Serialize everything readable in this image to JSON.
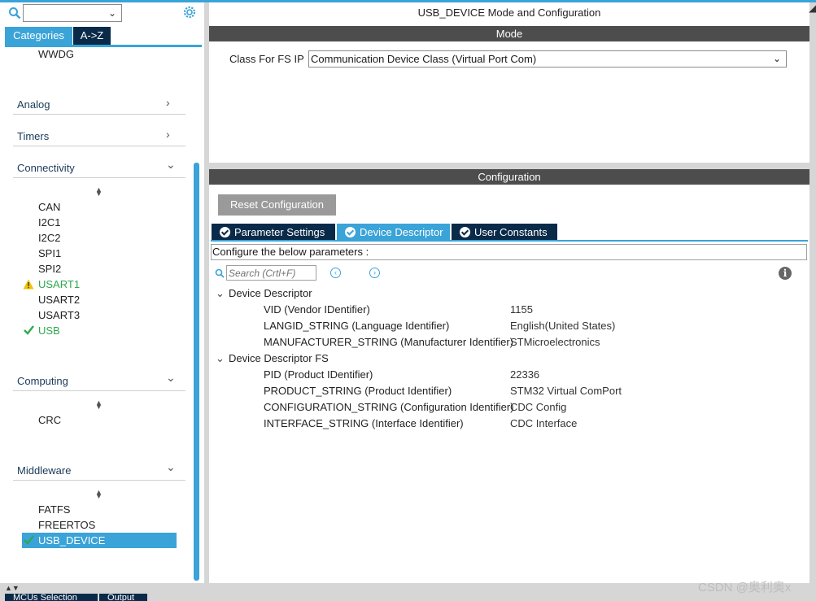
{
  "left": {
    "tabs": {
      "categories": "Categories",
      "az": "A->Z"
    },
    "top_item": "WWDG",
    "sections": {
      "analog": "Analog",
      "timers": "Timers",
      "connectivity": "Connectivity",
      "computing": "Computing",
      "middleware": "Middleware"
    },
    "connectivity_items": [
      "CAN",
      "I2C1",
      "I2C2",
      "SPI1",
      "SPI2",
      "USART1",
      "USART2",
      "USART3",
      "USB"
    ],
    "computing_items": [
      "CRC"
    ],
    "middleware_items": [
      "FATFS",
      "FREERTOS",
      "USB_DEVICE"
    ]
  },
  "mode": {
    "title": "USB_DEVICE Mode and Configuration",
    "bar": "Mode",
    "class_label": "Class For FS IP",
    "class_value": "Communication Device Class (Virtual Port Com)"
  },
  "config": {
    "bar": "Configuration",
    "reset_label": "Reset Configuration",
    "tabs": [
      "Parameter Settings",
      "Device Descriptor",
      "User Constants"
    ],
    "active_tab": "Device Descriptor",
    "hint": "Configure the below parameters :",
    "search_placeholder": "Search (Crtl+F)",
    "groups": [
      {
        "name": "Device Descriptor",
        "params": [
          {
            "name": "VID (Vendor IDentifier)",
            "value": "1155"
          },
          {
            "name": "LANGID_STRING (Language Identifier)",
            "value": "English(United States)"
          },
          {
            "name": "MANUFACTURER_STRING (Manufacturer Identifier)",
            "value": "STMicroelectronics"
          }
        ]
      },
      {
        "name": "Device Descriptor FS",
        "params": [
          {
            "name": "PID (Product IDentifier)",
            "value": "22336"
          },
          {
            "name": "PRODUCT_STRING (Product Identifier)",
            "value": "STM32 Virtual ComPort"
          },
          {
            "name": "CONFIGURATION_STRING (Configuration Identifier)",
            "value": "CDC Config"
          },
          {
            "name": "INTERFACE_STRING (Interface Identifier)",
            "value": "CDC Interface"
          }
        ]
      }
    ]
  },
  "bottom": {
    "tabs": [
      "MCUs Selection",
      "Output"
    ]
  },
  "watermark": "CSDN @奥利奥x",
  "colors": {
    "accent": "#3aa3d8",
    "dark_tab": "#0a2a4a",
    "bar": "#4d4d4d",
    "ok_green": "#2fa84f",
    "warn_yellow": "#f2c200"
  }
}
